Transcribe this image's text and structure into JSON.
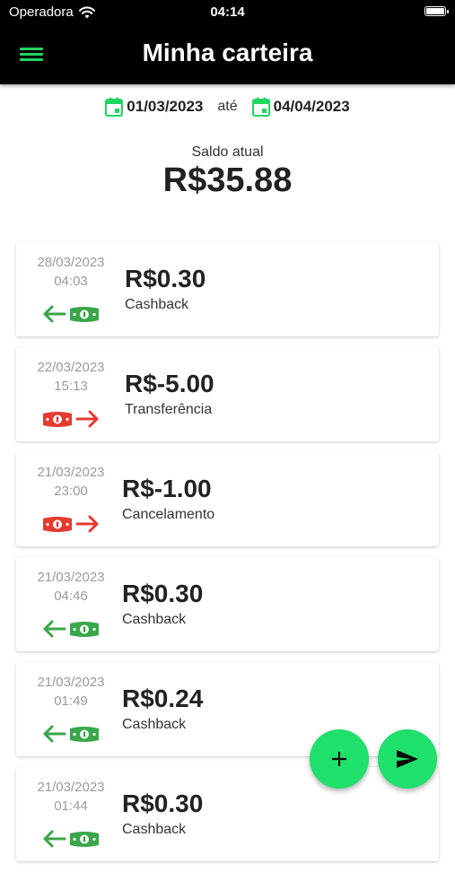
{
  "status_bar": {
    "carrier": "Operadora",
    "time": "04:14"
  },
  "header": {
    "title": "Minha carteira",
    "menu_icon": "menu-icon"
  },
  "date_range": {
    "start": "01/03/2023",
    "separator": "até",
    "end": "04/04/2023"
  },
  "balance": {
    "label": "Saldo atual",
    "value": "R$35.88"
  },
  "colors": {
    "accent": "#1fd65f",
    "income": "#3aa64a",
    "expense": "#e53a2f"
  },
  "transactions": [
    {
      "date": "28/03/2023",
      "time": "04:03",
      "amount": "R$0.30",
      "description": "Cashback",
      "direction": "in"
    },
    {
      "date": "22/03/2023",
      "time": "15:13",
      "amount": "R$-5.00",
      "description": "Transferência",
      "direction": "out"
    },
    {
      "date": "21/03/2023",
      "time": "23:00",
      "amount": "R$-1.00",
      "description": "Cancelamento",
      "direction": "out"
    },
    {
      "date": "21/03/2023",
      "time": "04:46",
      "amount": "R$0.30",
      "description": "Cashback",
      "direction": "in"
    },
    {
      "date": "21/03/2023",
      "time": "01:49",
      "amount": "R$0.24",
      "description": "Cashback",
      "direction": "in"
    },
    {
      "date": "21/03/2023",
      "time": "01:44",
      "amount": "R$0.30",
      "description": "Cashback",
      "direction": "in"
    }
  ],
  "fab": {
    "add_icon": "plus-icon",
    "send_icon": "send-icon"
  }
}
